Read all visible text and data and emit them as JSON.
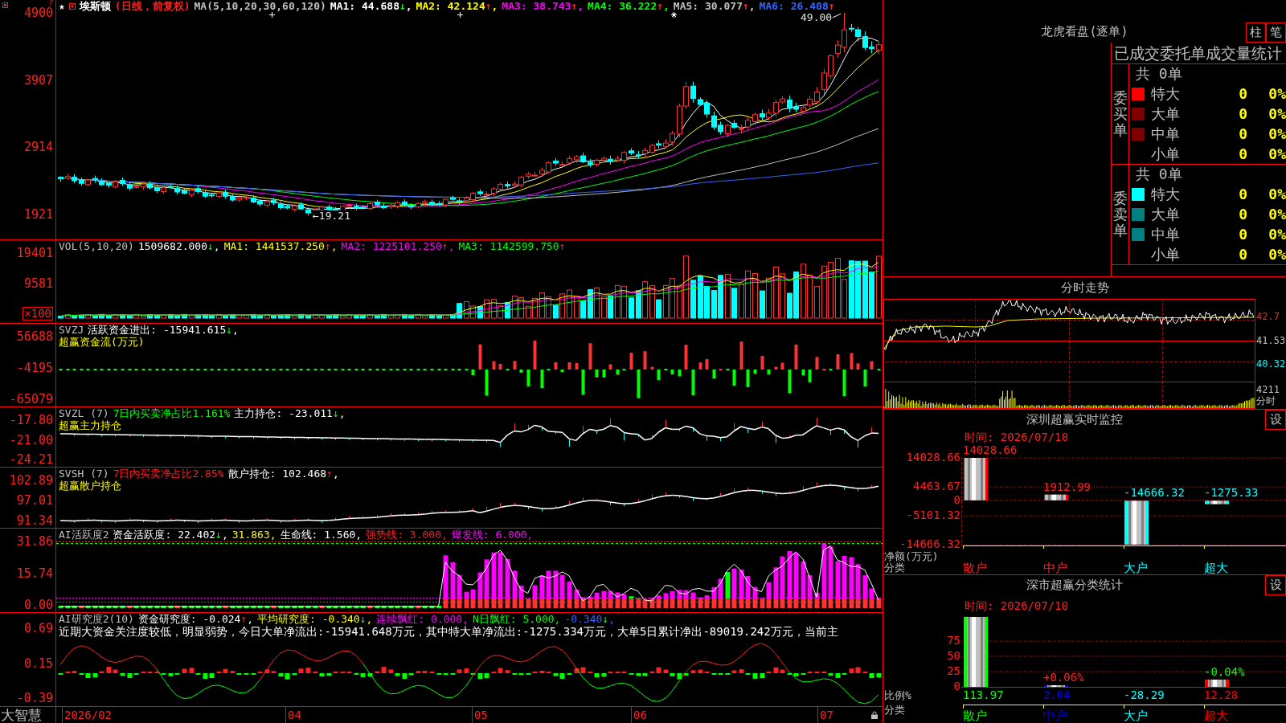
{
  "stock_chart": {
    "corner_mark": "?",
    "header": {
      "star": "★",
      "items": [
        {
          "text": "埃斯顿",
          "color": "#ffffff"
        },
        {
          "text": "(日线，前复权)",
          "color": "#ff2020"
        },
        {
          "text": "MA(5,10,20,30,60,120)",
          "color": "#c0c0c0"
        },
        {
          "text": "MA1: 44.688",
          "color": "#ffffff",
          "arrow": "↓",
          "rising": false,
          "suffix": ","
        },
        {
          "text": "MA2: 42.124",
          "color": "#ffff00",
          "arrow": "↑",
          "rising": true,
          "suffix": ","
        },
        {
          "text": "MA3: 38.743",
          "color": "#ff00ff",
          "arrow": "↑",
          "rising": true,
          "suffix": ","
        },
        {
          "text": "MA4: 36.222",
          "color": "#00ff00",
          "arrow": "↑",
          "rising": true,
          "suffix": ","
        },
        {
          "text": "MA5: 30.077",
          "color": "#c0c0c0",
          "arrow": "↑",
          "rising": true,
          "suffix": ","
        },
        {
          "text": "MA6: 26.408",
          "color": "#3366ff",
          "arrow": "↑",
          "rising": true
        }
      ]
    },
    "axis_labels": [
      "4900",
      "3907",
      "2914",
      "1921"
    ],
    "high_label": "49.00",
    "low_label": "←19.21"
  },
  "indicator_panes": [
    {
      "kind": "volume",
      "header": [
        {
          "text": "VOL(5,10,20)",
          "color": "#c0c0c0"
        },
        {
          "text": "1509682.000",
          "color": "#ffffff",
          "arrow": "↓",
          "rising": false,
          "suffix": ","
        },
        {
          "text": "MA1: 1441537.250",
          "color": "#ffff00",
          "arrow": "↑",
          "rising": true,
          "suffix": ","
        },
        {
          "text": "MA2: 1225101.250",
          "color": "#ff00ff",
          "arrow": "↑",
          "rising": true,
          "suffix": ","
        },
        {
          "text": "MA3: 1142599.750",
          "color": "#00ff00",
          "arrow": "↑",
          "rising": true
        }
      ],
      "axis_labels": [
        "19401",
        "9581"
      ],
      "unit_badge": "×100"
    },
    {
      "kind": "fund_flow",
      "header": [
        {
          "text": "SVZJ",
          "color": "#c0c0c0"
        },
        {
          "text": "活跃资金进出: -15941.615",
          "color": "#ffffff",
          "arrow": "↓",
          "rising": false,
          "suffix": ","
        }
      ],
      "subtitle": "超赢资金流(万元)",
      "axis_labels": [
        "56688",
        "-4195",
        "-65079"
      ]
    },
    {
      "kind": "main_holding",
      "header": [
        {
          "text": "SVZL (7)",
          "color": "#c0c0c0"
        },
        {
          "text": "7日内买卖净占比1.161%",
          "color": "#00ff00"
        },
        {
          "text": "主力持仓: -23.011",
          "color": "#ffffff",
          "arrow": "↓",
          "rising": false,
          "suffix": ","
        }
      ],
      "subtitle": "超赢主力持仓",
      "axis_labels": [
        "-17.80",
        "-21.00",
        "-24.21"
      ]
    },
    {
      "kind": "retail_holding",
      "header": [
        {
          "text": "SVSH (7)",
          "color": "#c0c0c0"
        },
        {
          "text": "7日内买卖净占比2.85%",
          "color": "#ff2020"
        },
        {
          "text": "散户持仓: 102.468",
          "color": "#ffffff",
          "arrow": "↑",
          "rising": true,
          "suffix": ","
        }
      ],
      "subtitle": "超赢散户持仓",
      "axis_labels": [
        "102.89",
        "97.01",
        "91.34"
      ]
    },
    {
      "kind": "activity",
      "header": [
        {
          "text": "AI活跃度2",
          "color": "#c0c0c0"
        },
        {
          "text": "资金活跃度: 22.402",
          "color": "#ffffff",
          "arrow": "↓",
          "rising": false,
          "suffix": ","
        },
        {
          "text": "31.863,",
          "color": "#ffff00"
        },
        {
          "text": "生命线: 1.560,",
          "color": "#ffffff"
        },
        {
          "text": "强势线: 3.000,",
          "color": "#ff2020"
        },
        {
          "text": "爆发线: 6.000,",
          "color": "#ff00ff"
        }
      ],
      "axis_labels": [
        "31.86",
        "15.74",
        "0.00"
      ]
    },
    {
      "kind": "research",
      "header": [
        {
          "text": "AI研究度2(10)",
          "color": "#c0c0c0"
        },
        {
          "text": "资金研究度: -0.024",
          "color": "#ffffff",
          "arrow": "↑",
          "rising": true,
          "suffix": ","
        },
        {
          "text": "平均研究度: -0.340",
          "color": "#ffff00",
          "arrow": "↓",
          "rising": false,
          "suffix": ","
        },
        {
          "text": "连续飘红: 0.000,",
          "color": "#ff00ff"
        },
        {
          "text": "N日飘红: 5.000,",
          "color": "#00ff00"
        },
        {
          "text": "-0.340",
          "color": "#3366ff",
          "arrow": "↓",
          "rising": false,
          "suffix": ","
        }
      ],
      "note": "近期大资金关注度较低，明显弱势，今日大单净流出:-15941.648万元，其中特大单净流出:-1275.334万元，大单5日累计净出-89019.242万元，当前主",
      "axis_labels": [
        "0.69",
        "0.15",
        "-0.39"
      ]
    }
  ],
  "footer": {
    "brand": "大智慧",
    "dates": [
      "2026/02",
      "04",
      "05",
      "06",
      "07"
    ]
  },
  "order_panel": {
    "title": "龙虎看盘(逐单)",
    "view_buttons": [
      "柱",
      "笔"
    ],
    "table_title": "已成交委托单成交量统计",
    "groups": [
      {
        "label": "委买单",
        "total": "共 0单",
        "rows": [
          {
            "label": "特大",
            "color": "#ff0000",
            "count": "0",
            "percent": "0%"
          },
          {
            "label": "大单",
            "color": "#800000",
            "count": "0",
            "percent": "0%"
          },
          {
            "label": "中单",
            "color": "#800000",
            "count": "0",
            "percent": "0%"
          },
          {
            "label": "小单",
            "count": "0",
            "percent": "0%"
          }
        ]
      },
      {
        "label": "委卖单",
        "total": "共 0单",
        "rows": [
          {
            "label": "特大",
            "color": "#00ffff",
            "count": "0",
            "percent": "0%"
          },
          {
            "label": "大单",
            "color": "#008080",
            "count": "0",
            "percent": "0%"
          },
          {
            "label": "中单",
            "color": "#008080",
            "count": "0",
            "percent": "0%"
          },
          {
            "label": "小单",
            "count": "0",
            "percent": "0%"
          }
        ]
      }
    ]
  },
  "intraday": {
    "title": "分时走势",
    "price_labels": [
      {
        "text": "42.7",
        "kind": "high"
      },
      {
        "text": "41.53",
        "kind": "mid"
      },
      {
        "text": "40.32",
        "kind": "low"
      }
    ],
    "volume_label": "4211",
    "period_label": "分时"
  },
  "sz_monitor": {
    "title": "深圳超赢实时监控",
    "settings_button": "设",
    "time": "时间: 2026/07/10",
    "chart_data": {
      "type": "bar",
      "xlabel": "分类",
      "ylabel": "净额(万元)",
      "categories": [
        "散户",
        "中户",
        "大户",
        "超大"
      ],
      "values": [
        14028.66,
        1912.99,
        -14666.32,
        -1275.33
      ],
      "ylim": [
        -14666.32,
        14028.66
      ],
      "yticks": [
        14028.66,
        4463.67,
        0,
        -5101.32,
        -14666.32
      ],
      "grid": true,
      "data_labels": true
    }
  },
  "sz_classification": {
    "title": "深市超赢分类统计",
    "settings_button": "设",
    "time": "时间: 2026/07/10",
    "bars": [
      {
        "color": "#00ff00"
      },
      {
        "color": "#0000ff",
        "note": {
          "text": "+0.06%",
          "color": "#ff2020"
        }
      },
      {
        "color": "#00ffff"
      },
      {
        "color": "#ff0000",
        "note": {
          "text": "-0.04%",
          "color": "#00ff00"
        }
      }
    ],
    "chart_data": {
      "type": "bar",
      "xlabel": "分类",
      "ylabel": "比例%",
      "categories": [
        "散户",
        "中户",
        "大户",
        "超大"
      ],
      "values": [
        113.97,
        2.04,
        null,
        12.28
      ],
      "value_labels": [
        "113.97",
        "2.04",
        "-28.29",
        "12.28"
      ],
      "ylim": [
        0,
        115
      ],
      "yticks": [
        0,
        25,
        50,
        75
      ],
      "grid": true
    }
  }
}
